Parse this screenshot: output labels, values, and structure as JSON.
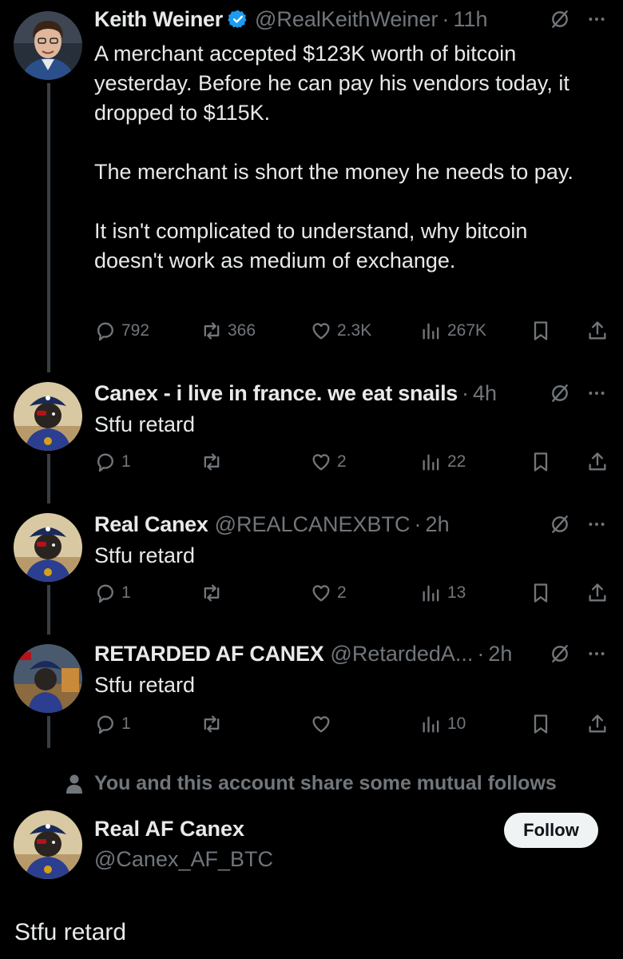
{
  "posts": [
    {
      "name": "Keith Weiner",
      "verified": true,
      "handle": "@RealKeithWeiner",
      "time": "11h",
      "text": "A merchant accepted $123K worth of bitcoin yesterday. Before he can pay his vendors today, it dropped to $115K.\n\nThe merchant is short the money he needs to pay.\n\nIt isn't complicated to understand, why bitcoin doesn't work as medium of exchange.",
      "replies": "792",
      "reposts": "366",
      "likes": "2.3K",
      "views": "267K"
    },
    {
      "name": "Canex - i live in france. we eat snails",
      "handle": "",
      "time": "4h",
      "text": "Stfu retard",
      "replies": "1",
      "reposts": "",
      "likes": "2",
      "views": "22"
    },
    {
      "name": "Real Canex",
      "handle": "@REALCANEXBTC",
      "time": "2h",
      "text": "Stfu retard",
      "replies": "1",
      "reposts": "",
      "likes": "2",
      "views": "13"
    },
    {
      "name": "RETARDED AF CANEX",
      "handle": "@RetardedA...",
      "time": "2h",
      "text": "Stfu retard",
      "replies": "1",
      "reposts": "",
      "likes": "",
      "views": "10"
    }
  ],
  "mutual_notice": "You and this account share some mutual follows",
  "focus": {
    "name": "Real AF Canex",
    "handle": "@Canex_AF_BTC",
    "follow_label": "Follow",
    "text": "Stfu retard"
  },
  "dot": "·",
  "icons": {
    "reply": "reply-icon",
    "repost": "repost-icon",
    "like": "heart-icon",
    "views": "views-icon",
    "bookmark": "bookmark-icon",
    "share": "share-icon",
    "grok": "grok-icon",
    "more": "more-icon",
    "verified": "verified-badge-icon",
    "person": "person-icon"
  },
  "colors": {
    "background": "#000000",
    "text": "#e7e9ea",
    "muted": "#71767b",
    "verified": "#1d9bf0",
    "thread_line": "#3a3f44",
    "button": "#eff3f4"
  }
}
